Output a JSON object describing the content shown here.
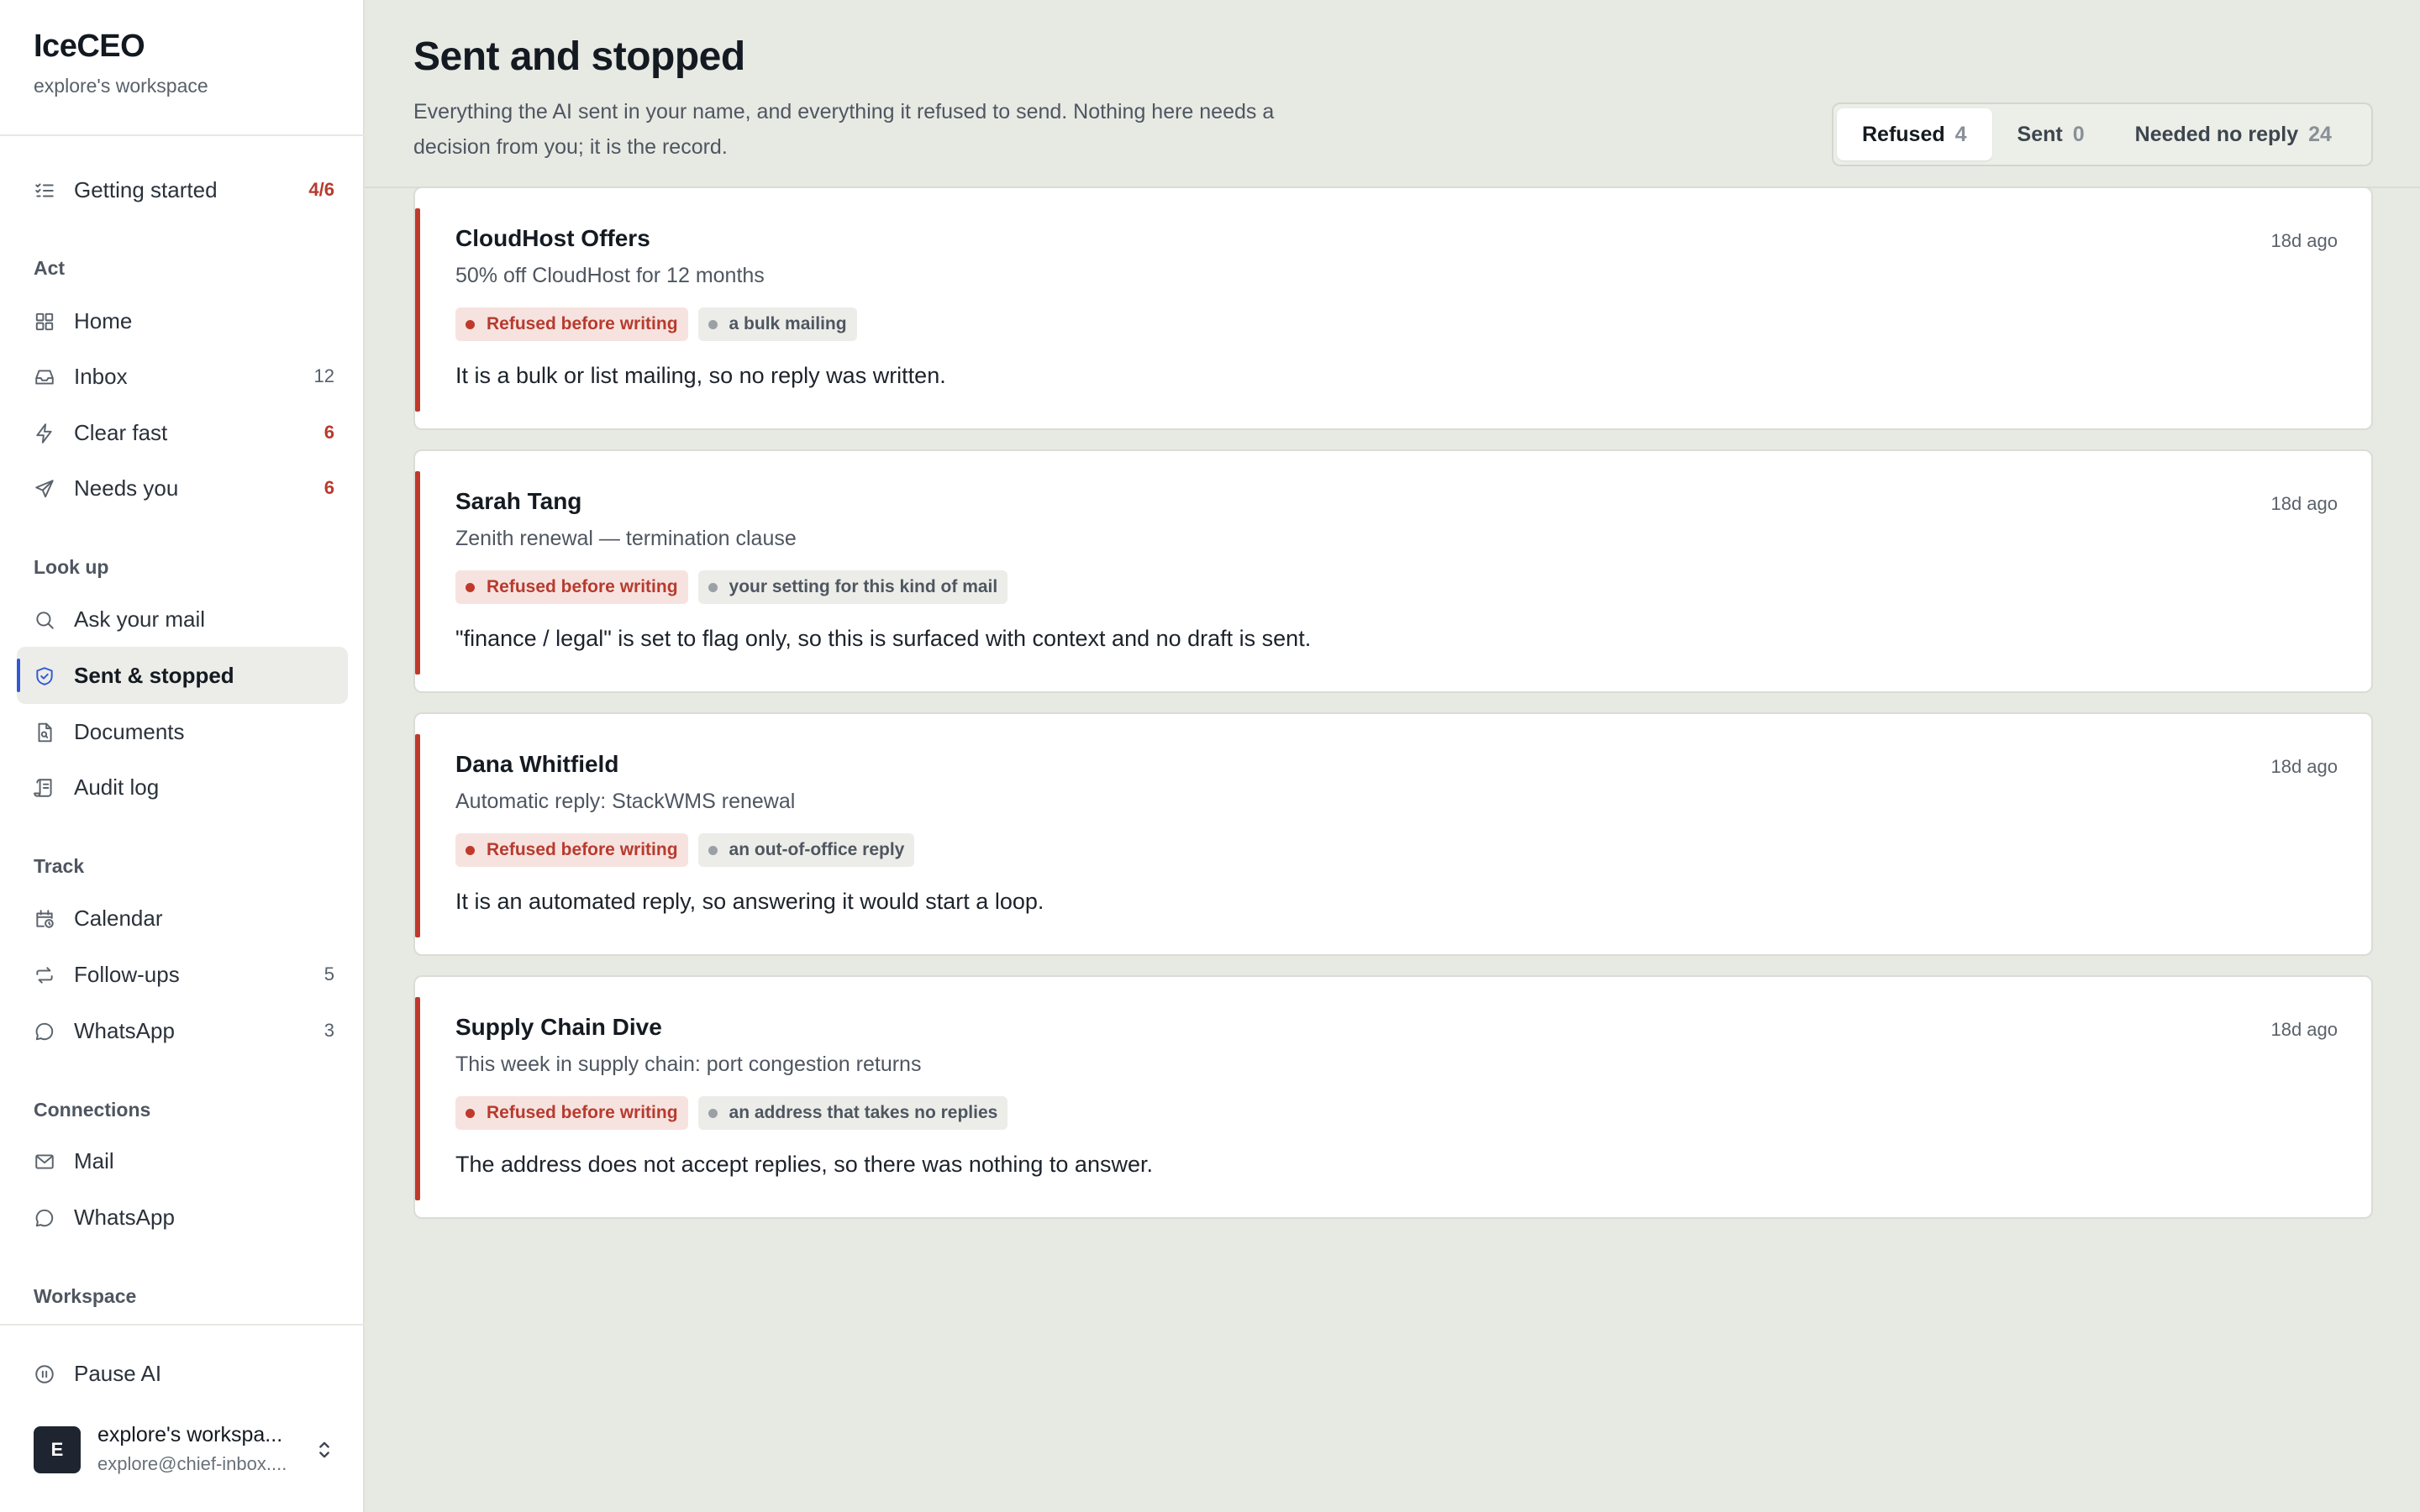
{
  "app": {
    "name": "IceCEO",
    "workspace": "explore's workspace"
  },
  "sidebar": {
    "getting_started": {
      "label": "Getting started",
      "count": "4/6",
      "icon": "checklist-icon"
    },
    "sections": {
      "act": "Act",
      "look_up": "Look up",
      "track": "Track",
      "connections": "Connections",
      "workspace": "Workspace"
    },
    "act_items": [
      {
        "label": "Home",
        "count": "",
        "icon": "grid-icon"
      },
      {
        "label": "Inbox",
        "count": "12",
        "icon": "inbox-icon"
      },
      {
        "label": "Clear fast",
        "count": "6",
        "icon": "lightning-icon"
      },
      {
        "label": "Needs you",
        "count": "6",
        "icon": "send-icon"
      }
    ],
    "lookup_items": [
      {
        "label": "Ask your mail",
        "icon": "search-icon"
      },
      {
        "label": "Sent & stopped",
        "icon": "shield-icon",
        "active": true
      },
      {
        "label": "Documents",
        "icon": "document-icon"
      },
      {
        "label": "Audit log",
        "icon": "scroll-icon"
      }
    ],
    "track_items": [
      {
        "label": "Calendar",
        "count": "",
        "icon": "calendar-clock-icon"
      },
      {
        "label": "Follow-ups",
        "count": "5",
        "icon": "repeat-icon"
      },
      {
        "label": "WhatsApp",
        "count": "3",
        "icon": "chat-bubble-icon"
      }
    ],
    "connection_items": [
      {
        "label": "Mail",
        "icon": "mail-icon"
      },
      {
        "label": "WhatsApp",
        "icon": "chat-bubble-icon"
      }
    ],
    "pause": {
      "label": "Pause AI",
      "icon": "pause-icon"
    },
    "account": {
      "initial": "E",
      "name": "explore's workspa...",
      "email": "explore@chief-inbox...."
    }
  },
  "page": {
    "title": "Sent and stopped",
    "description": "Everything the AI sent in your name, and everything it refused to send. Nothing here needs a decision from you; it is the record.",
    "filters": [
      {
        "label": "Refused",
        "count": "4",
        "active": true
      },
      {
        "label": "Sent",
        "count": "0",
        "active": false
      },
      {
        "label": "Needed no reply",
        "count": "24",
        "active": false
      }
    ]
  },
  "cards": [
    {
      "sender": "CloudHost Offers",
      "subject": "50% off CloudHost for 12 months",
      "time": "18d ago",
      "status_tag": "Refused before writing",
      "reason_tag": "a bulk mailing",
      "reason": "It is a bulk or list mailing, so no reply was written."
    },
    {
      "sender": "Sarah Tang",
      "subject": "Zenith renewal — termination clause",
      "time": "18d ago",
      "status_tag": "Refused before writing",
      "reason_tag": "your setting for this kind of mail",
      "reason": "\"finance / legal\" is set to flag only, so this is surfaced with context and no draft is sent."
    },
    {
      "sender": "Dana Whitfield",
      "subject": "Automatic reply: StackWMS renewal",
      "time": "18d ago",
      "status_tag": "Refused before writing",
      "reason_tag": "an out-of-office reply",
      "reason": "It is an automated reply, so answering it would start a loop."
    },
    {
      "sender": "Supply Chain Dive",
      "subject": "This week in supply chain: port congestion returns",
      "time": "18d ago",
      "status_tag": "Refused before writing",
      "reason_tag": "an address that takes no replies",
      "reason": "The address does not accept replies, so there was nothing to answer."
    }
  ],
  "colors": {
    "accent": "#3358d4",
    "refused": "#c0392b",
    "background": "#e7e9e3"
  }
}
